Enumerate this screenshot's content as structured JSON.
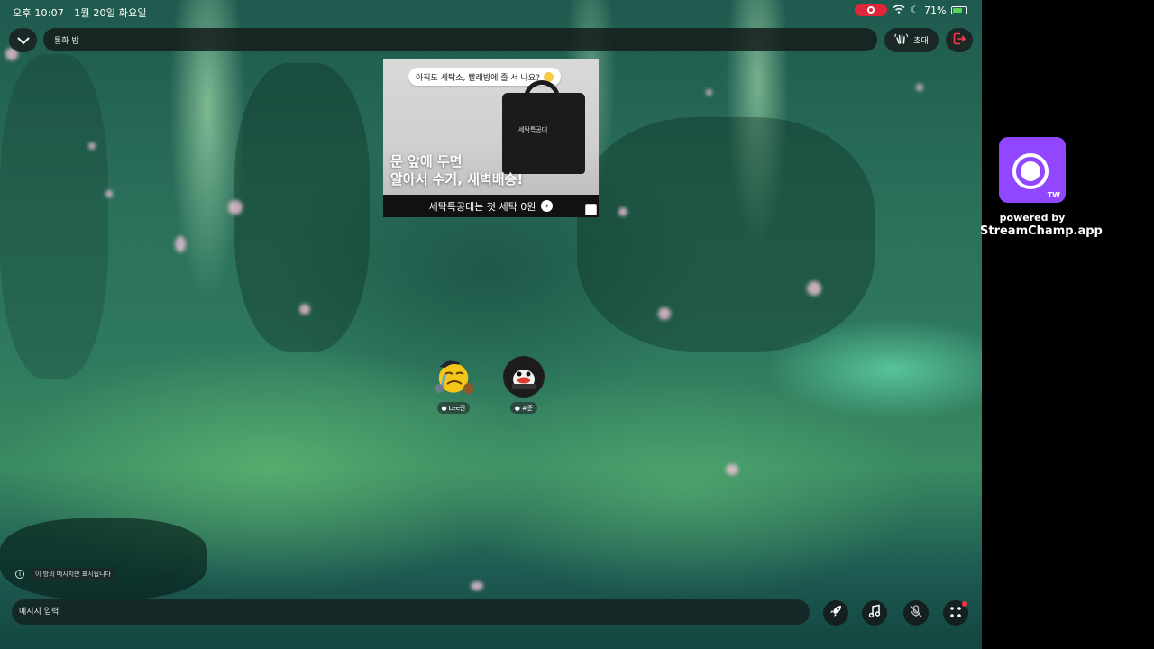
{
  "status_bar": {
    "time": "오후 10:07",
    "date": "1월 20일 화요일",
    "battery": "71%",
    "battery_level": 0.71,
    "battery_color": "#5bd35b",
    "recording_color": "#e0263a"
  },
  "header": {
    "room_title": "통화 방",
    "invite_label": "초대",
    "collapse_icon": "chevron-down-icon",
    "exit_icon": "exit-icon"
  },
  "ad": {
    "bubble_text": "아직도 세탁소, 빨래방에 줄 서 나요?",
    "bag_label": "세탁특공대",
    "headline_line1": "문 앞에 두면",
    "headline_line2": "알아서 수거, 새벽배송!",
    "cta_text": "세탁특공대는 첫 세탁 0원"
  },
  "participants": [
    {
      "name": "Lee란",
      "avatar_icon": "crying-emoji-pirate-avatar"
    },
    {
      "name": "#준",
      "avatar_icon": "penguin-avatar"
    }
  ],
  "notice": {
    "text": "이 방의 메시지만 표시됩니다"
  },
  "message_input": {
    "placeholder": "메시지 입력"
  },
  "toolbar": {
    "buttons": [
      "rocket-icon",
      "music-icon",
      "mic-off-icon",
      "more-icon"
    ]
  },
  "sidebar": {
    "logo_text": "TW",
    "powered_by": "powered by",
    "app_name": "StreamChamp.app",
    "accent": "#9146ff"
  }
}
